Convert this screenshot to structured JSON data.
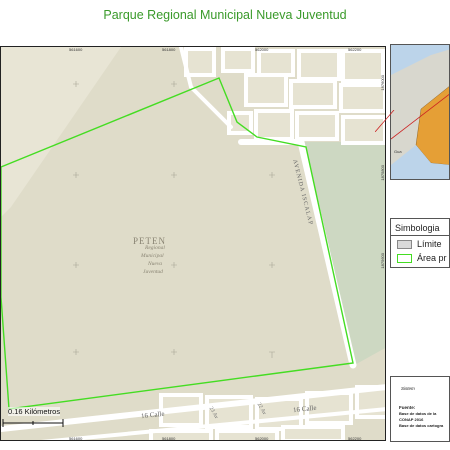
{
  "title": "Parque Regional Municipal Nueva Juventud",
  "map": {
    "place_label": "PETEN",
    "park_label_lines": [
      "Regional",
      "Municipal",
      "Nueva",
      "Juventud"
    ],
    "street_labels": {
      "avenida": "AVENIDA ISCALAP",
      "calle_16_a": "16 Calle",
      "calle_16_b": "16 Calle",
      "avenida_22": "22 Av",
      "avenida_23": "23 Av"
    },
    "x_coords_top": [
      "561600",
      "561800",
      "562000",
      "562200"
    ],
    "x_coords_bottom": [
      "561600",
      "561800",
      "562000",
      "562200"
    ],
    "y_coords_right": [
      "1876000",
      "1875800",
      "1875600"
    ],
    "scale_label": "0.16 Kilómetros",
    "colors": {
      "background": "#dfdcc9",
      "boundary": "#44dd22",
      "vegetation": "#cdd8c2",
      "roads": "#ffffff",
      "blocks": "#e6e3d2"
    }
  },
  "legend": {
    "title": "Simbologia",
    "items": [
      {
        "label": "Límite",
        "swatch": "#d9d9d9",
        "border": "#888888"
      },
      {
        "label": "Área pr",
        "swatch": "#ffffff",
        "border": "#44dd22"
      }
    ]
  },
  "info": {
    "system": "Sistem",
    "fuente": "Fuente:",
    "lines": [
      "Base de datos de la",
      "CONAP 2016",
      "Base de datos cartogra"
    ]
  },
  "inset": {
    "label": "Gua"
  }
}
